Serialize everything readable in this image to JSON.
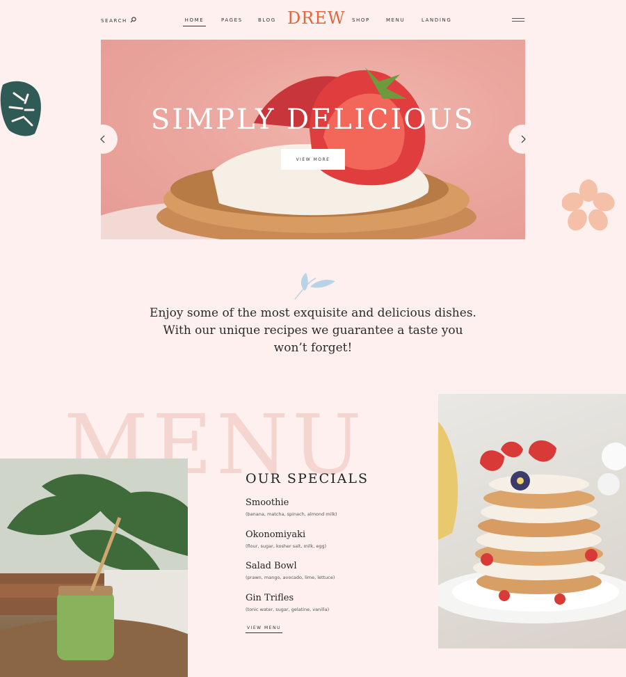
{
  "header": {
    "search_label": "SEARCH",
    "nav_left": [
      "HOME",
      "PAGES",
      "BLOG"
    ],
    "logo": "DREW",
    "nav_right": [
      "SHOP",
      "MENU",
      "LANDING"
    ]
  },
  "hero": {
    "title": "SIMPLY DELICIOUS",
    "button_label": "VIEW MORE"
  },
  "intro": {
    "text": "Enjoy some of the most exquisite and delicious dishes. With our unique recipes we guarantee a taste you won’t forget!"
  },
  "menu": {
    "watermark": "MENU",
    "title": "OUR SPECIALS",
    "items": [
      {
        "name": "Smoothie",
        "desc": "(banana, matcha, spinach, almond milk)"
      },
      {
        "name": "Okonomiyaki",
        "desc": "(flour, sugar, kosher salt, milk, egg)"
      },
      {
        "name": "Salad Bowl",
        "desc": "(prawn, mango, avocado, lime, lettuce)"
      },
      {
        "name": "Gin Trifles",
        "desc": "(tonic water, sugar, gelatine, vanilla)"
      }
    ],
    "view_menu_label": "VIEW MENU"
  },
  "colors": {
    "background": "#fdf0ee",
    "accent": "#e0673e",
    "hero_pink": "#eba79f",
    "watermark": "#f5d5d0",
    "leaf_dark": "#2f5a55",
    "flower": "#f4c0a8",
    "sprig": "#b9d3e6"
  },
  "icons": [
    "search-icon",
    "menu-hamburger-icon",
    "chevron-left-icon",
    "chevron-right-icon",
    "monstera-leaf-icon",
    "flower-icon",
    "leaf-sprig-icon"
  ]
}
